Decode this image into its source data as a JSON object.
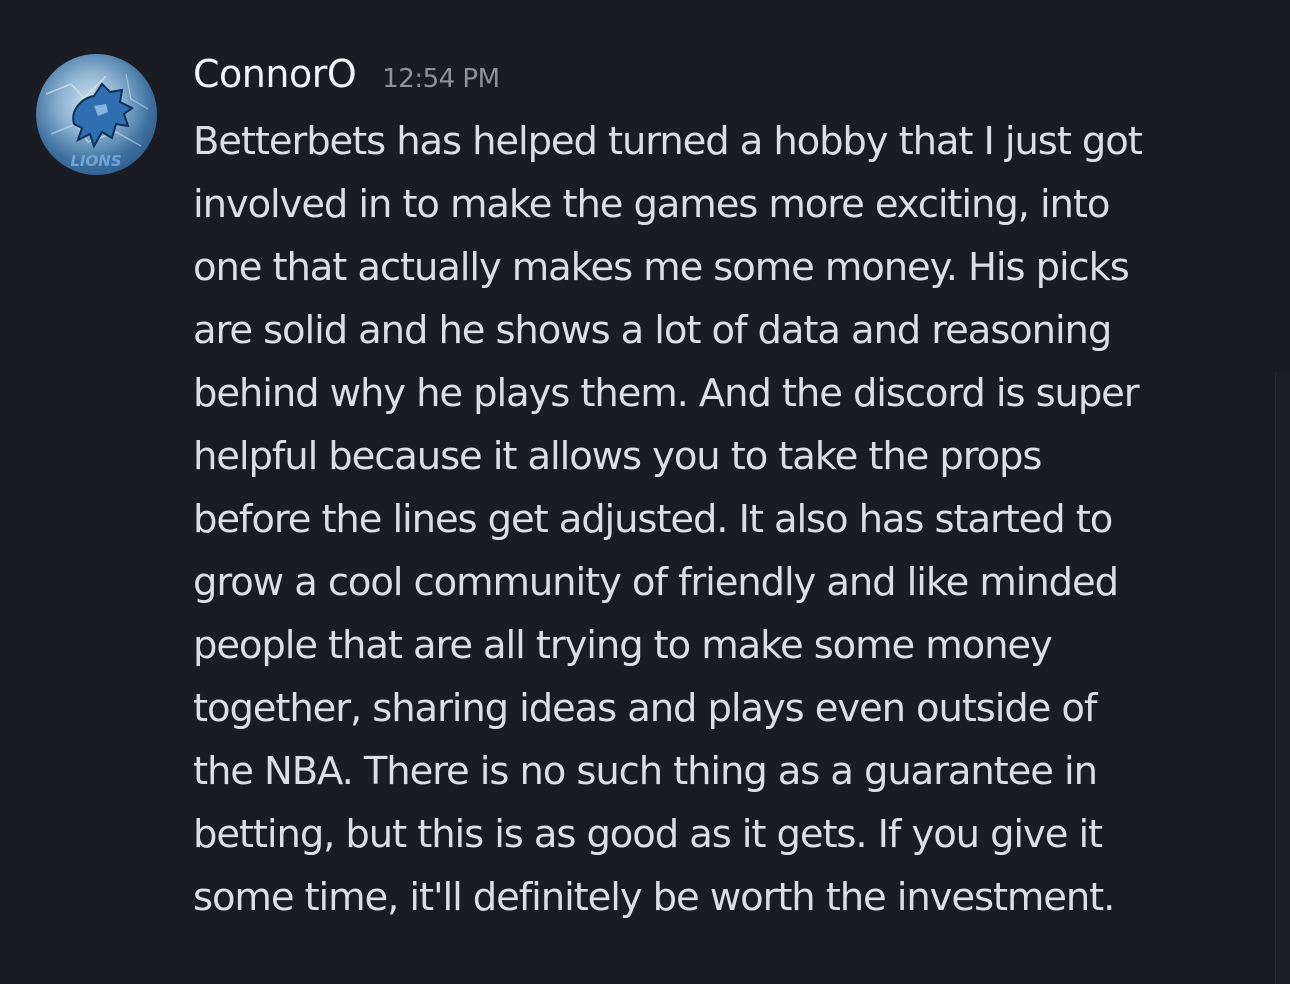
{
  "message": {
    "author": "ConnorO",
    "timestamp": "12:54 PM",
    "avatar_icon": "lions-logo-icon",
    "avatar_caption": "LIONS",
    "text": "Betterbets has helped turned a hobby that I just got\ninvolved in to make the games more exciting, into\none that actually makes me some money. His picks\nare solid and he shows a lot of data and reasoning\nbehind why he plays them. And the discord is super\nhelpful because it allows you to take the props\nbefore the lines get adjusted. It also has started to\ngrow a cool community of friendly and like minded\npeople that are all trying to make some money\ntogether, sharing ideas and plays even outside of\nthe NBA. There is no such thing as a guarantee in\nbetting, but this is as good as it gets. If you give it\nsome time, it'll definitely be worth the investment."
  },
  "colors": {
    "background": "#1b1c21",
    "username": "#f2f3f5",
    "timestamp": "#8e9199",
    "body_text": "#dcdee2"
  }
}
